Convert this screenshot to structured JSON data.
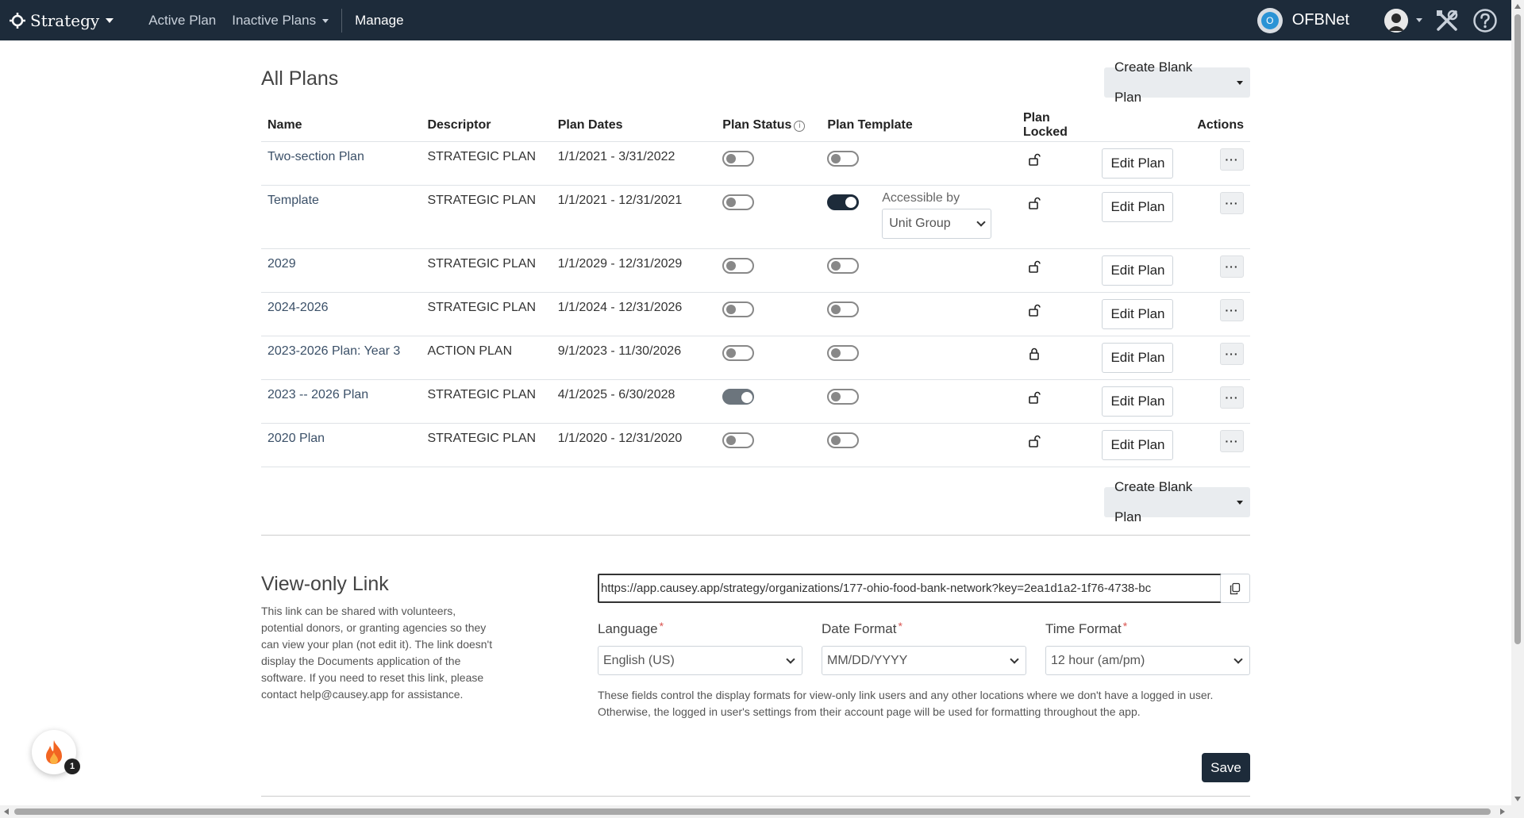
{
  "topbar": {
    "brand": "Strategy",
    "nav": {
      "active_plan": "Active Plan",
      "inactive_plans": "Inactive Plans",
      "manage": "Manage"
    },
    "org_name": "OFBNet",
    "org_badge_letter": "O"
  },
  "page": {
    "title": "All Plans",
    "create_button": "Create Blank Plan"
  },
  "table": {
    "headers": {
      "name": "Name",
      "descriptor": "Descriptor",
      "plan_dates": "Plan Dates",
      "plan_status": "Plan Status",
      "plan_template": "Plan Template",
      "plan_locked": "Plan Locked",
      "actions": "Actions"
    },
    "edit_label": "Edit Plan",
    "more_label": "···",
    "access_label": "Accessible by",
    "access_value": "Unit Group",
    "rows": [
      {
        "name": "Two-section Plan",
        "descriptor": "STRATEGIC PLAN",
        "dates": "1/1/2021 - 3/31/2022",
        "status": "off",
        "template": "off",
        "locked": false
      },
      {
        "name": "Template",
        "descriptor": "STRATEGIC PLAN",
        "dates": "1/1/2021 - 12/31/2021",
        "status": "off",
        "template": "on",
        "locked": false
      },
      {
        "name": "2029",
        "descriptor": "STRATEGIC PLAN",
        "dates": "1/1/2029 - 12/31/2029",
        "status": "off",
        "template": "off",
        "locked": false
      },
      {
        "name": "2024-2026",
        "descriptor": "STRATEGIC PLAN",
        "dates": "1/1/2024 - 12/31/2026",
        "status": "off",
        "template": "off",
        "locked": false
      },
      {
        "name": "2023-2026 Plan: Year 3",
        "descriptor": "ACTION PLAN",
        "dates": "9/1/2023 - 11/30/2026",
        "status": "off",
        "template": "off",
        "locked": true
      },
      {
        "name": "2023 -- 2026 Plan",
        "descriptor": "STRATEGIC PLAN",
        "dates": "4/1/2025 - 6/30/2028",
        "status": "active",
        "template": "off",
        "locked": false
      },
      {
        "name": "2020 Plan",
        "descriptor": "STRATEGIC PLAN",
        "dates": "1/1/2020 - 12/31/2020",
        "status": "off",
        "template": "off",
        "locked": false
      }
    ]
  },
  "view_only": {
    "title": "View-only Link",
    "description": "This link can be shared with volunteers, potential donors, or granting agencies so they can view your plan (not edit it). The link doesn't display the Documents application of the software. If you need to reset this link, please contact help@causey.app for assistance.",
    "link": "https://app.causey.app/strategy/organizations/177-ohio-food-bank-network?key=2ea1d1a2-1f76-4738-bc",
    "language_label": "Language",
    "language_value": "English (US)",
    "date_format_label": "Date Format",
    "date_format_value": "MM/DD/YYYY",
    "time_format_label": "Time Format",
    "time_format_value": "12 hour (am/pm)",
    "required_mark": "*",
    "help_text": "These fields control the display formats for view-only link users and any other locations where we don't have a logged in user. Otherwise, the logged in user's settings from their account page will be used for formatting throughout the app.",
    "save": "Save"
  },
  "widget": {
    "badge_count": "1"
  },
  "colors": {
    "navbar": "#1d2b3a",
    "accent": "#1d2b3a",
    "required": "#d9534f"
  }
}
